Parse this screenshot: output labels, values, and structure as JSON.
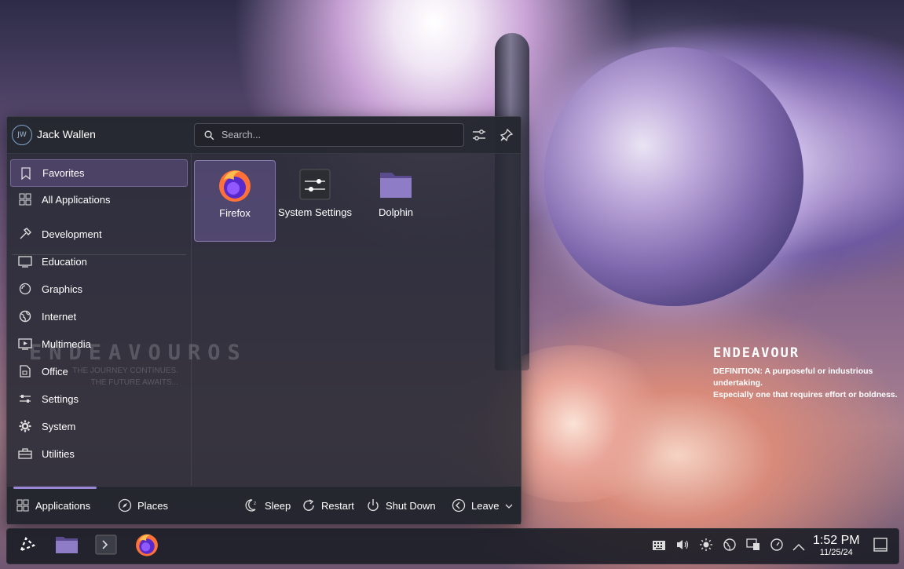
{
  "wallpaper": {
    "brand_logo": "ENDEAVOUROS",
    "brand_sub_1": "THE JOURNEY CONTINUES.",
    "brand_sub_2": "THE FUTURE AWAITS...",
    "word": "ENDEAVOUR",
    "definition_1": "DEFINITION: A purposeful or industrious undertaking.",
    "definition_2": "Especially one that requires effort or boldness."
  },
  "launcher": {
    "user": {
      "initials": "JW",
      "name": "Jack Wallen"
    },
    "search": {
      "placeholder": "Search..."
    },
    "categories": [
      {
        "label": "Favorites",
        "icon": "bookmark-icon"
      },
      {
        "label": "All Applications",
        "icon": "grid-icon"
      },
      {
        "label": "Development",
        "icon": "hammer-icon"
      },
      {
        "label": "Education",
        "icon": "monitor-icon"
      },
      {
        "label": "Graphics",
        "icon": "graphics-icon"
      },
      {
        "label": "Internet",
        "icon": "globe-icon"
      },
      {
        "label": "Multimedia",
        "icon": "video-icon"
      },
      {
        "label": "Office",
        "icon": "document-icon"
      },
      {
        "label": "Settings",
        "icon": "sliders-icon"
      },
      {
        "label": "System",
        "icon": "gear-icon"
      },
      {
        "label": "Utilities",
        "icon": "toolbox-icon"
      }
    ],
    "apps": [
      {
        "label": "Firefox",
        "icon": "firefox-icon"
      },
      {
        "label": "System Settings",
        "icon": "system-settings-icon"
      },
      {
        "label": "Dolphin",
        "icon": "folder-icon"
      }
    ],
    "footer": {
      "applications": "Applications",
      "places": "Places",
      "sleep": "Sleep",
      "restart": "Restart",
      "shutdown": "Shut Down",
      "leave": "Leave"
    }
  },
  "taskbar": {
    "time": "1:52 PM",
    "date": "11/25/24"
  },
  "colors": {
    "accent": "#9a86d4",
    "panel": "#282a34"
  }
}
